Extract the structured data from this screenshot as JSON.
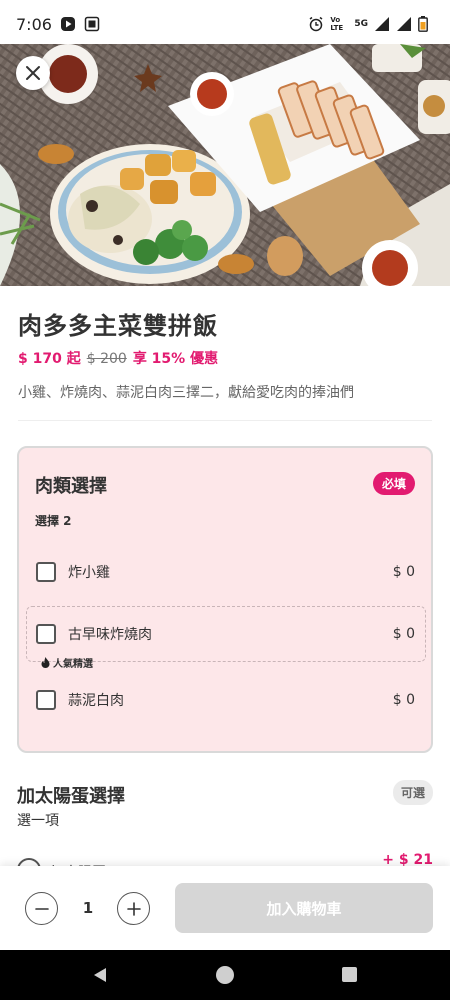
{
  "status_bar": {
    "time": "7:06",
    "network": "5G",
    "volte": "Vo LTE"
  },
  "dish": {
    "title": "肉多多主菜雙拼飯",
    "price": "$ 170 起",
    "old_price": "$ 200",
    "discount": "享 15% 優惠",
    "description": "小雞、炸燒肉、蒜泥白肉三擇二，獻給愛吃肉的捧油們"
  },
  "group1": {
    "title": "肉類選擇",
    "badge": "必填",
    "subtitle": "選擇 2",
    "options": [
      {
        "label": "炸小雞",
        "price": "$ 0"
      },
      {
        "label": "古早味炸燒肉",
        "price": "$ 0"
      },
      {
        "label": "蒜泥白肉",
        "price": "$ 0"
      }
    ],
    "popular_tag": "人氣精選"
  },
  "group2": {
    "title": "加太陽蛋選擇",
    "subtitle": "選一項",
    "badge": "可選",
    "peek_option": {
      "label": "加太陽蛋",
      "price": "+ $ 21"
    }
  },
  "cart": {
    "quantity": "1",
    "add_button": "加入購物車"
  },
  "colors": {
    "brand_pink": "#e21b70",
    "card_bg": "#fde7e9",
    "disabled_button": "#d6d6d6"
  }
}
